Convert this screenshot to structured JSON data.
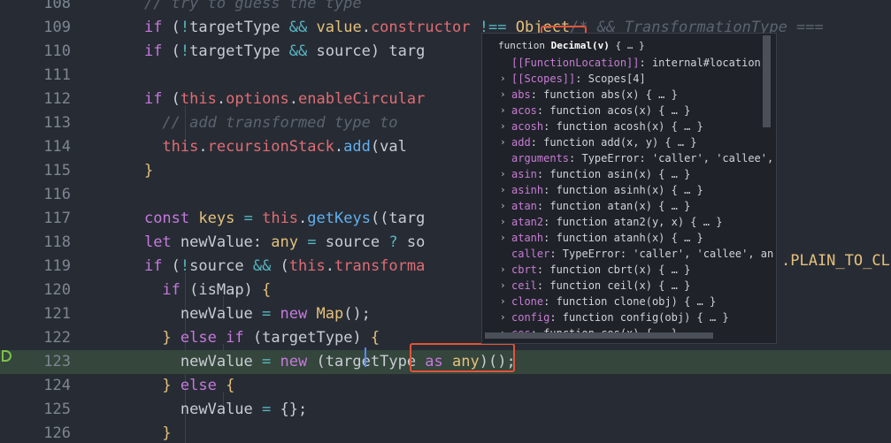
{
  "editor": {
    "colors": {
      "background": "#272c34",
      "active_line": "#35463c",
      "highlight_border": "#e0553a"
    },
    "lines": [
      {
        "num": "108",
        "tokens": [
          [
            "    ",
            ""
          ],
          [
            "// try to guess the type",
            "#5c6370"
          ]
        ]
      },
      {
        "num": "109",
        "tokens": [
          [
            "    ",
            ""
          ],
          [
            "if",
            "#c678dd"
          ],
          [
            " (",
            ""
          ],
          [
            "!",
            "#56b6c2"
          ],
          [
            "targetType ",
            ""
          ],
          [
            "&&",
            "#56b6c2"
          ],
          [
            " ",
            ""
          ],
          [
            "value",
            "#e5c07b"
          ],
          [
            ".",
            ""
          ],
          [
            "constructor",
            "#e06c75"
          ],
          [
            " ",
            ""
          ],
          [
            "!==",
            "#56b6c2"
          ],
          [
            " ",
            ""
          ],
          [
            "Object",
            "#e5c07b"
          ],
          [
            "/* && TransformationType ===",
            "#5c6370"
          ]
        ]
      },
      {
        "num": "110",
        "tokens": [
          [
            "    ",
            ""
          ],
          [
            "if",
            "#c678dd"
          ],
          [
            " (",
            ""
          ],
          [
            "!",
            "#56b6c2"
          ],
          [
            "targetType ",
            ""
          ],
          [
            "&&",
            "#56b6c2"
          ],
          [
            " source) targ",
            ""
          ]
        ]
      },
      {
        "num": "111",
        "tokens": []
      },
      {
        "num": "112",
        "tokens": [
          [
            "    ",
            ""
          ],
          [
            "if",
            "#c678dd"
          ],
          [
            " (",
            ""
          ],
          [
            "this",
            "#e06c75"
          ],
          [
            ".",
            ""
          ],
          [
            "options",
            "#e06c75"
          ],
          [
            ".",
            ""
          ],
          [
            "enableCircular",
            "#e06c75"
          ]
        ]
      },
      {
        "num": "113",
        "tokens": [
          [
            "      ",
            ""
          ],
          [
            "// add transformed type to",
            "#5c6370"
          ]
        ]
      },
      {
        "num": "114",
        "tokens": [
          [
            "      ",
            ""
          ],
          [
            "this",
            "#e06c75"
          ],
          [
            ".",
            ""
          ],
          [
            "recursionStack",
            "#e06c75"
          ],
          [
            ".",
            ""
          ],
          [
            "add",
            "#61afef"
          ],
          [
            "(val",
            ""
          ]
        ]
      },
      {
        "num": "115",
        "tokens": [
          [
            "    ",
            ""
          ],
          [
            "}",
            "#e5c07b"
          ]
        ]
      },
      {
        "num": "116",
        "tokens": []
      },
      {
        "num": "117",
        "tokens": [
          [
            "    ",
            ""
          ],
          [
            "const",
            "#c678dd"
          ],
          [
            " ",
            ""
          ],
          [
            "keys",
            "#e5c07b"
          ],
          [
            " ",
            ""
          ],
          [
            "=",
            "#56b6c2"
          ],
          [
            " ",
            ""
          ],
          [
            "this",
            "#e06c75"
          ],
          [
            ".",
            ""
          ],
          [
            "getKeys",
            "#61afef"
          ],
          [
            "((targ",
            ""
          ]
        ]
      },
      {
        "num": "118",
        "tokens": [
          [
            "    ",
            ""
          ],
          [
            "let",
            "#c678dd"
          ],
          [
            " newValue: ",
            ""
          ],
          [
            "any",
            "#e5c07b"
          ],
          [
            " ",
            ""
          ],
          [
            "=",
            "#56b6c2"
          ],
          [
            " source ",
            ""
          ],
          [
            "?",
            "#56b6c2"
          ],
          [
            " so",
            ""
          ]
        ]
      },
      {
        "num": "119",
        "tokens": [
          [
            "    ",
            ""
          ],
          [
            "if",
            "#c678dd"
          ],
          [
            " (",
            ""
          ],
          [
            "!",
            "#56b6c2"
          ],
          [
            "source ",
            ""
          ],
          [
            "&&",
            "#56b6c2"
          ],
          [
            " (",
            ""
          ],
          [
            "this",
            "#e06c75"
          ],
          [
            ".",
            ""
          ],
          [
            "transforma",
            "#e06c75"
          ]
        ]
      },
      {
        "num": "120",
        "tokens": [
          [
            "      ",
            ""
          ],
          [
            "if",
            "#c678dd"
          ],
          [
            " (isMap) ",
            ""
          ],
          [
            "{",
            "#e5c07b"
          ]
        ]
      },
      {
        "num": "121",
        "tokens": [
          [
            "        ",
            ""
          ],
          [
            "newValue ",
            ""
          ],
          [
            "=",
            "#56b6c2"
          ],
          [
            " ",
            ""
          ],
          [
            "new",
            "#c678dd"
          ],
          [
            " ",
            ""
          ],
          [
            "Map",
            "#e5c07b"
          ],
          [
            "();",
            ""
          ]
        ]
      },
      {
        "num": "122",
        "tokens": [
          [
            "      ",
            ""
          ],
          [
            "}",
            "#e5c07b"
          ],
          [
            " ",
            ""
          ],
          [
            "else",
            "#c678dd"
          ],
          [
            " ",
            ""
          ],
          [
            "if",
            "#c678dd"
          ],
          [
            " (targetType) ",
            ""
          ],
          [
            "{",
            "#e5c07b"
          ]
        ]
      },
      {
        "num": "123",
        "tokens": [
          [
            "        ",
            ""
          ],
          [
            "newValue ",
            ""
          ],
          [
            "=",
            "#56b6c2"
          ],
          [
            " ",
            ""
          ],
          [
            "new",
            "#c678dd"
          ],
          [
            " (targetType ",
            ""
          ],
          [
            "as",
            "#c678dd"
          ],
          [
            " ",
            ""
          ],
          [
            "any",
            "#e5c07b"
          ],
          [
            ")();",
            ""
          ]
        ]
      },
      {
        "num": "124",
        "tokens": [
          [
            "      ",
            ""
          ],
          [
            "}",
            "#e5c07b"
          ],
          [
            " ",
            ""
          ],
          [
            "else",
            "#c678dd"
          ],
          [
            " ",
            ""
          ],
          [
            "{",
            "#e5c07b"
          ]
        ]
      },
      {
        "num": "125",
        "tokens": [
          [
            "        ",
            ""
          ],
          [
            "newValue ",
            ""
          ],
          [
            "=",
            "#56b6c2"
          ],
          [
            " {};",
            ""
          ]
        ]
      },
      {
        "num": "126",
        "tokens": [
          [
            "      ",
            ""
          ],
          [
            "}",
            "#e5c07b"
          ]
        ]
      }
    ],
    "right_fragment": {
      "text": ".PLAIN_TO_CL",
      "color": "#e5c07b"
    }
  },
  "popup": {
    "header_prefix": "function ",
    "header_name": "Decimal(v)",
    "header_suffix": " { … }",
    "rows": [
      {
        "chevron": "",
        "key": "[[FunctionLocation]]",
        "value": ": internal#location"
      },
      {
        "chevron": "›",
        "key": "[[Scopes]]",
        "value": ": Scopes[4]"
      },
      {
        "chevron": "›",
        "key": "abs",
        "value": ": function abs(x) { … }"
      },
      {
        "chevron": "›",
        "key": "acos",
        "value": ": function acos(x) { … }"
      },
      {
        "chevron": "›",
        "key": "acosh",
        "value": ": function acosh(x) { … }"
      },
      {
        "chevron": "›",
        "key": "add",
        "value": ": function add(x, y) { … }"
      },
      {
        "chevron": "",
        "key": "arguments",
        "value": ": TypeError: 'caller', 'callee', and"
      },
      {
        "chevron": "›",
        "key": "asin",
        "value": ": function asin(x) { … }"
      },
      {
        "chevron": "›",
        "key": "asinh",
        "value": ": function asinh(x) { … }"
      },
      {
        "chevron": "›",
        "key": "atan",
        "value": ": function atan(x) { … }"
      },
      {
        "chevron": "›",
        "key": "atan2",
        "value": ": function atan2(y, x) { … }"
      },
      {
        "chevron": "›",
        "key": "atanh",
        "value": ": function atanh(x) { … }"
      },
      {
        "chevron": "",
        "key": "caller",
        "value": ": TypeError: 'caller', 'callee', and 'c"
      },
      {
        "chevron": "›",
        "key": "cbrt",
        "value": ": function cbrt(x) { … }"
      },
      {
        "chevron": "›",
        "key": "ceil",
        "value": ": function ceil(x) { … }"
      },
      {
        "chevron": "›",
        "key": "clone",
        "value": ": function clone(obj) { … }"
      },
      {
        "chevron": "›",
        "key": "config",
        "value": ": function config(obj) { … }"
      },
      {
        "chevron": "›",
        "key": "cos",
        "value": ": function cos(x) { … }"
      }
    ]
  }
}
